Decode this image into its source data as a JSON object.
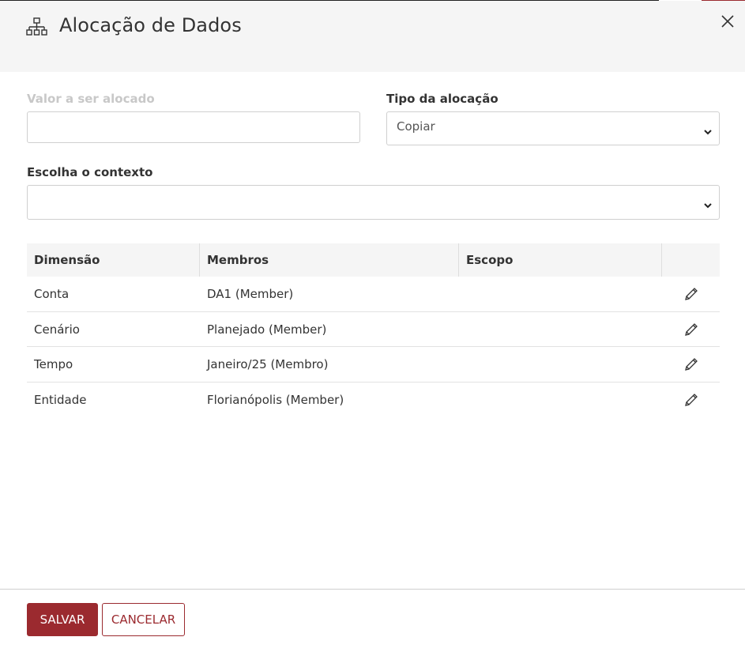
{
  "dialog": {
    "title": "Alocação de Dados",
    "title_icon": "hierarchy-icon",
    "close_icon": "close-icon"
  },
  "form": {
    "valor_label": "Valor a ser alocado",
    "valor_value": "",
    "tipo_label": "Tipo da alocação",
    "tipo_selected": "Copiar",
    "contexto_label": "Escolha o contexto",
    "contexto_selected": ""
  },
  "table": {
    "columns": [
      "Dimensão",
      "Membros",
      "Escopo",
      ""
    ],
    "rows": [
      {
        "dimensao": "Conta",
        "membros": "DA1 (Member)",
        "escopo": ""
      },
      {
        "dimensao": "Cenário",
        "membros": "Planejado (Member)",
        "escopo": ""
      },
      {
        "dimensao": "Tempo",
        "membros": "Janeiro/25 (Membro)",
        "escopo": ""
      },
      {
        "dimensao": "Entidade",
        "membros": "Florianópolis (Member)",
        "escopo": ""
      }
    ],
    "row_action_icon": "pencil-icon"
  },
  "footer": {
    "save_label": "SALVAR",
    "cancel_label": "CANCELAR"
  },
  "colors": {
    "accent": "#9b2a2f",
    "header_bg": "#f5f5f5"
  }
}
